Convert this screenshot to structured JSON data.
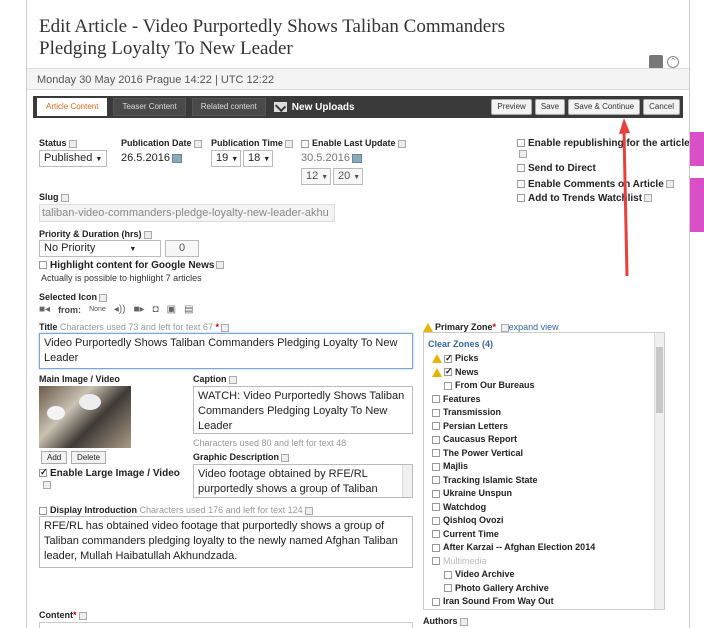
{
  "page": {
    "title_line1": "Edit Article - Video Purportedly Shows Taliban Commanders",
    "title_line2": "Pledging Loyalty To New Leader",
    "date_line": "Monday 30 May 2016 Prague 14:22 | UTC 12:22"
  },
  "tabs": [
    {
      "label": "Article Content",
      "active": true
    },
    {
      "label": "Teaser Content",
      "active": false
    },
    {
      "label": "Related content",
      "active": false
    }
  ],
  "uploads_label": "New Uploads",
  "toolbar": {
    "preview": "Preview",
    "save": "Save",
    "save_continue": "Save & Continue",
    "cancel": "Cancel"
  },
  "status": {
    "label": "Status",
    "value": "Published"
  },
  "publication_date": {
    "label": "Publication Date",
    "value": "26.5.2016"
  },
  "publication_time": {
    "label": "Publication Time",
    "hour": "19",
    "minute": "18"
  },
  "last_update": {
    "label": "Enable Last Update",
    "date": "30.5.2016",
    "hour": "12",
    "minute": "20"
  },
  "right_options": [
    {
      "label": "Enable republishing for the article",
      "checked": false
    },
    {
      "label": "Send to Direct",
      "checked": false
    },
    {
      "label": "Enable Comments on Article",
      "checked": false
    },
    {
      "label": "Add to Trends Watchlist",
      "checked": false
    }
  ],
  "slug": {
    "label": "Slug",
    "value": "taliban-video-commanders-pledge-loyalty-new-leader-akhu"
  },
  "priority": {
    "label": "Priority & Duration (hrs)",
    "value": "No Priority",
    "duration": "0",
    "highlight_label": "Highlight content for Google News",
    "highlight_note": "Actually is possible to highlight 7 articles"
  },
  "selected_icon": {
    "label": "Selected Icon",
    "from": "from:",
    "none": "None"
  },
  "title_field": {
    "label": "Title",
    "hint": "Characters used 73 and left for text 67",
    "req": "*",
    "value": "Video Purportedly Shows Taliban Commanders Pledging Loyalty To New Leader"
  },
  "main_image": {
    "label": "Main Image / Video",
    "add": "Add",
    "delete": "Delete",
    "large_label": "Enable Large Image / Video"
  },
  "caption": {
    "label": "Caption",
    "value": "WATCH: Video Purportedly Shows Taliban Commanders Pledging Loyalty To New Leader",
    "hint": "Characters used 80 and left for text 48"
  },
  "graphic_description": {
    "label": "Graphic Description",
    "value": "Video footage obtained by RFE/RL purportedly shows a group of Taliban"
  },
  "introduction": {
    "label": "Display Introduction",
    "hint": "Characters used 176 and left for text 124",
    "value": "RFE/RL has obtained video footage that purportedly shows a group of Taliban commanders pledging loyalty to the newly named Afghan Taliban leader, Mullah Haibatullah Akhundzada."
  },
  "content_label": "Content",
  "authors_label": "Authors",
  "primary_zone": {
    "label": "Primary Zone",
    "req": "*",
    "expand": "expand view",
    "clear": "Clear Zones (4)",
    "items": [
      {
        "label": "Picks",
        "checked": true,
        "warn": true,
        "indent": 0
      },
      {
        "label": "News",
        "checked": true,
        "warn": true,
        "indent": 0
      },
      {
        "label": "From Our Bureaus",
        "checked": false,
        "indent": 1
      },
      {
        "label": "Features",
        "checked": false,
        "indent": 0
      },
      {
        "label": "Transmission",
        "checked": false,
        "indent": 0
      },
      {
        "label": "Persian Letters",
        "checked": false,
        "indent": 0
      },
      {
        "label": "Caucasus Report",
        "checked": false,
        "indent": 0
      },
      {
        "label": "The Power Vertical",
        "checked": false,
        "indent": 0
      },
      {
        "label": "Majlis",
        "checked": false,
        "indent": 0
      },
      {
        "label": "Tracking Islamic State",
        "checked": false,
        "indent": 0
      },
      {
        "label": "Ukraine Unspun",
        "checked": false,
        "indent": 0
      },
      {
        "label": "Watchdog",
        "checked": false,
        "indent": 0
      },
      {
        "label": "Qishloq Ovozi",
        "checked": false,
        "indent": 0
      },
      {
        "label": "Current Time",
        "checked": false,
        "indent": 0
      },
      {
        "label": "After Karzai -- Afghan Election 2014",
        "checked": false,
        "indent": 0
      },
      {
        "label": "Multimedia",
        "checked": false,
        "indent": 0,
        "disabled": true
      },
      {
        "label": "Video Archive",
        "checked": false,
        "indent": 1
      },
      {
        "label": "Photo Gallery Archive",
        "checked": false,
        "indent": 1
      },
      {
        "label": "Iran Sound From Way Out",
        "checked": false,
        "indent": 0
      }
    ]
  },
  "colors": {
    "accent_tab": "#e06a1b",
    "toolbar_bg": "#3a3a3a",
    "annotation_arrow": "#e8413c",
    "link": "#3366aa"
  }
}
